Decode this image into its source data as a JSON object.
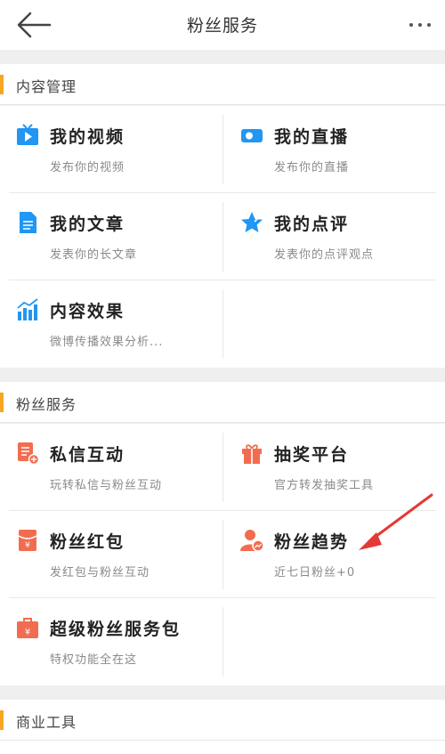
{
  "header": {
    "title": "粉丝服务",
    "back_icon": "arrow-left-icon",
    "more_icon": "more-dots-icon"
  },
  "sections": [
    {
      "label": "内容管理",
      "items": [
        {
          "title": "我的视频",
          "sub": "发布你的视频",
          "icon": "video-icon",
          "color": "#2196f3"
        },
        {
          "title": "我的直播",
          "sub": "发布你的直播",
          "icon": "live-camera-icon",
          "color": "#2196f3"
        },
        {
          "title": "我的文章",
          "sub": "发表你的长文章",
          "icon": "document-icon",
          "color": "#2196f3"
        },
        {
          "title": "我的点评",
          "sub": "发表你的点评观点",
          "icon": "star-review-icon",
          "color": "#2196f3"
        },
        {
          "title": "内容效果",
          "sub": "微博传播效果分析...",
          "icon": "bar-chart-icon",
          "color": "#2196f3"
        }
      ]
    },
    {
      "label": "粉丝服务",
      "items": [
        {
          "title": "私信互动",
          "sub": "玩转私信与粉丝互动",
          "icon": "message-add-icon",
          "color": "#f26d50"
        },
        {
          "title": "抽奖平台",
          "sub": "官方转发抽奖工具",
          "icon": "gift-icon",
          "color": "#f26d50"
        },
        {
          "title": "粉丝红包",
          "sub": "发红包与粉丝互动",
          "icon": "red-packet-icon",
          "color": "#f26d50"
        },
        {
          "title": "粉丝趋势",
          "sub": "近七日粉丝+0",
          "icon": "fans-trend-icon",
          "color": "#f26d50"
        },
        {
          "title": "超级粉丝服务包",
          "sub": "特权功能全在这",
          "icon": "service-bag-icon",
          "color": "#f26d50"
        }
      ]
    },
    {
      "label": "商业工具",
      "items": []
    }
  ],
  "annotation": {
    "color": "#e53935",
    "icon": "red-arrow-annotation"
  }
}
